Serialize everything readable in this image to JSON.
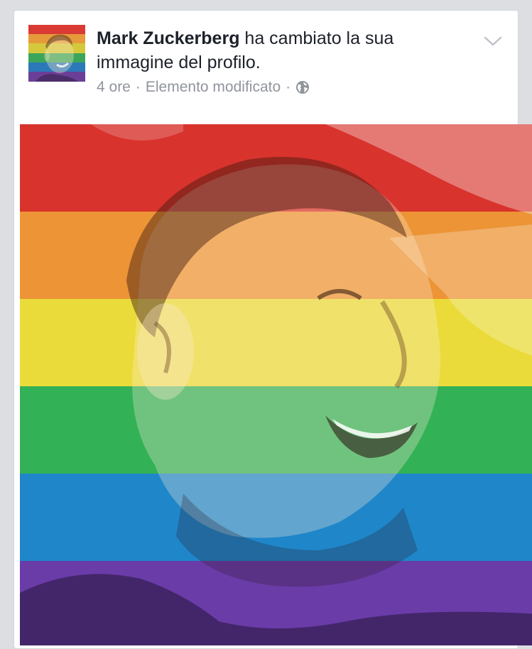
{
  "post": {
    "author_name": "Mark Zuckerberg",
    "action_text": "ha cambiato la sua immagine del profilo.",
    "time": "4 ore",
    "edited": "Elemento modificato",
    "separator": "·",
    "audience_icon": "globe-icon",
    "menu_icon": "chevron-down-icon"
  },
  "colors": {
    "name": "#1d2129",
    "meta": "#90949c",
    "rainbow": [
      "#e0252b",
      "#f7931d",
      "#f4e31c",
      "#22b14c",
      "#1f7fd6",
      "#7b3fb0"
    ]
  }
}
